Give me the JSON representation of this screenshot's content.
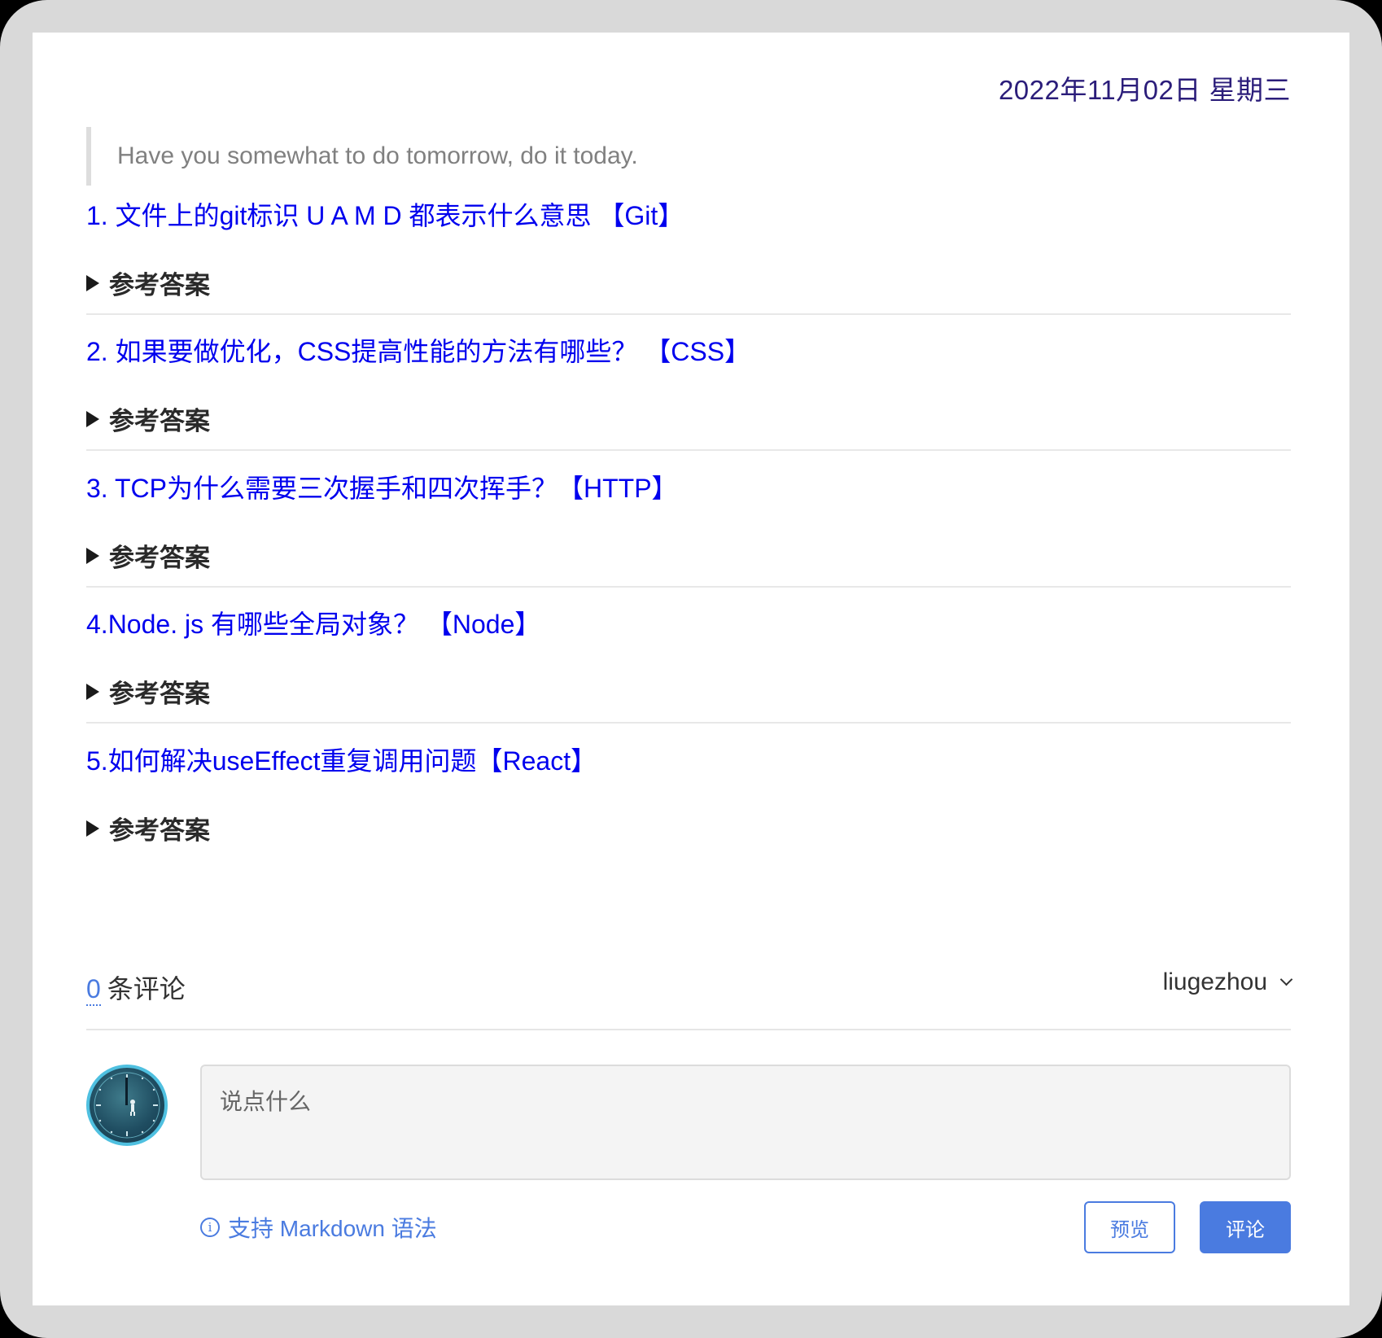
{
  "date": "2022年11月02日 星期三",
  "quote": "Have you somewhat to do tomorrow, do it today.",
  "questions": [
    {
      "title": "1. 文件上的git标识 U A M D 都表示什么意思 【Git】",
      "answer_label": "参考答案"
    },
    {
      "title": "2. 如果要做优化，CSS提高性能的方法有哪些？ 【CSS】",
      "answer_label": "参考答案"
    },
    {
      "title": "3. TCP为什么需要三次握手和四次挥手？【HTTP】",
      "answer_label": "参考答案"
    },
    {
      "title": "4.Node. js 有哪些全局对象？ 【Node】",
      "answer_label": "参考答案"
    },
    {
      "title": "5.如何解决useEffect重复调用问题【React】",
      "answer_label": "参考答案"
    }
  ],
  "comments": {
    "count": "0",
    "count_label": "条评论",
    "user": "liugezhou",
    "placeholder": "说点什么",
    "markdown_hint": "支持 Markdown 语法",
    "preview_label": "预览",
    "submit_label": "评论"
  },
  "colors": {
    "link": "#0000ee",
    "accent": "#4a7be0",
    "date": "#2b1d7a"
  },
  "icons": {
    "info": "info-circle-icon",
    "dropdown": "chevron-down-icon",
    "toggle": "triangle-right-icon",
    "avatar": "clock-avatar"
  }
}
